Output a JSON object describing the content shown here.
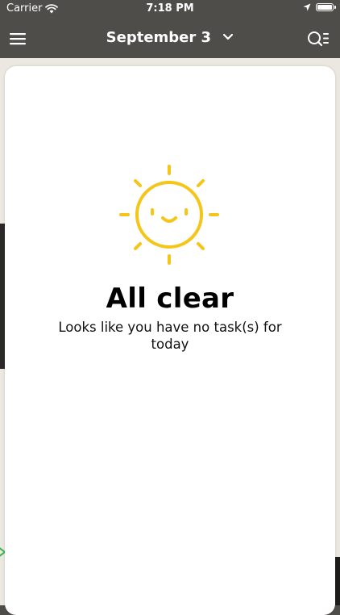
{
  "status_bar": {
    "carrier": "Carrier",
    "time": "7:18 PM"
  },
  "nav": {
    "date_label": "September 3",
    "icons": [
      "hamburger-menu-icon",
      "chevron-down-icon",
      "search-list-icon"
    ]
  },
  "empty_state": {
    "illustration": "smiling-sun-icon",
    "title": "All clear",
    "message": "Looks like you have no task(s) for today"
  },
  "colors": {
    "header_bg": "#4f4d49",
    "sun_yellow": "#f5c518",
    "card_bg": "#ffffff",
    "backdrop": "#ebe8e2"
  }
}
